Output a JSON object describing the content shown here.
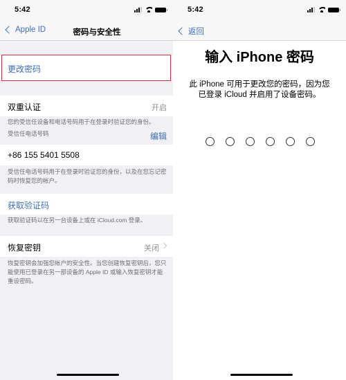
{
  "left": {
    "status": {
      "time": "5:42"
    },
    "nav": {
      "back_label": "Apple ID",
      "title": "密码与安全性"
    },
    "change_password": {
      "label": "更改密码",
      "highlighted": true
    },
    "two_factor": {
      "label": "双重认证",
      "value": "开启",
      "footer": "您的受信任设备和电话号码用于在登录时验证您的身份。",
      "trusted_label": "受信任电话号码",
      "edit_label": "编辑"
    },
    "phone": {
      "number": "+86 155 5401 5508",
      "footer": "受信任电话号码用于在登录时验证您的身份，以及在您忘记密码时恢复您的帐户。"
    },
    "verification": {
      "label": "获取验证码",
      "footer": "获取验证码以在另一台设备上或在 iCloud.com 登录。"
    },
    "recovery_key": {
      "label": "恢复密钥",
      "value": "关闭",
      "footer": "恢复密钥会加强您帐户的安全性。当您创建恢复密钥后，您只能使用已登录在另一部设备的 Apple ID 或输入恢复密钥才能重设密码。"
    }
  },
  "right": {
    "status": {
      "time": "5:42"
    },
    "nav": {
      "back_label": "返回"
    },
    "title": "输入 iPhone 密码",
    "description": "此 iPhone 可用于更改您的密码，因为您已登录 iCloud 并启用了设备密码。",
    "passcode": {
      "length": 6,
      "entered": 0
    }
  },
  "colors": {
    "accent": "#3f6fb5",
    "highlight": "#c8303a",
    "grouped_bg": "#f0f0f5"
  }
}
